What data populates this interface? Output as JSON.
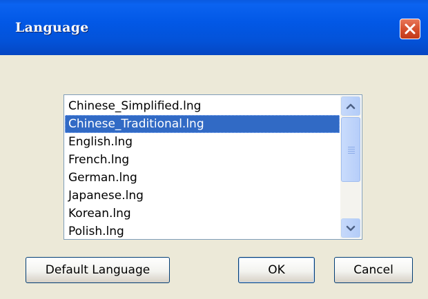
{
  "dialog": {
    "title": "Language",
    "close_icon": "close-x-icon"
  },
  "language_list": {
    "items": [
      {
        "label": "Chinese_Simplified.lng",
        "selected": false
      },
      {
        "label": "Chinese_Traditional.lng",
        "selected": true
      },
      {
        "label": "English.lng",
        "selected": false
      },
      {
        "label": "French.lng",
        "selected": false
      },
      {
        "label": "German.lng",
        "selected": false
      },
      {
        "label": "Japanese.lng",
        "selected": false
      },
      {
        "label": "Korean.lng",
        "selected": false
      },
      {
        "label": "Polish.lng",
        "selected": false
      }
    ]
  },
  "buttons": {
    "default_language": "Default Language",
    "ok": "OK",
    "cancel": "Cancel"
  },
  "colors": {
    "titlebar": "#0258e6",
    "selection": "#316ac5",
    "dialog_bg": "#ece9d8"
  }
}
